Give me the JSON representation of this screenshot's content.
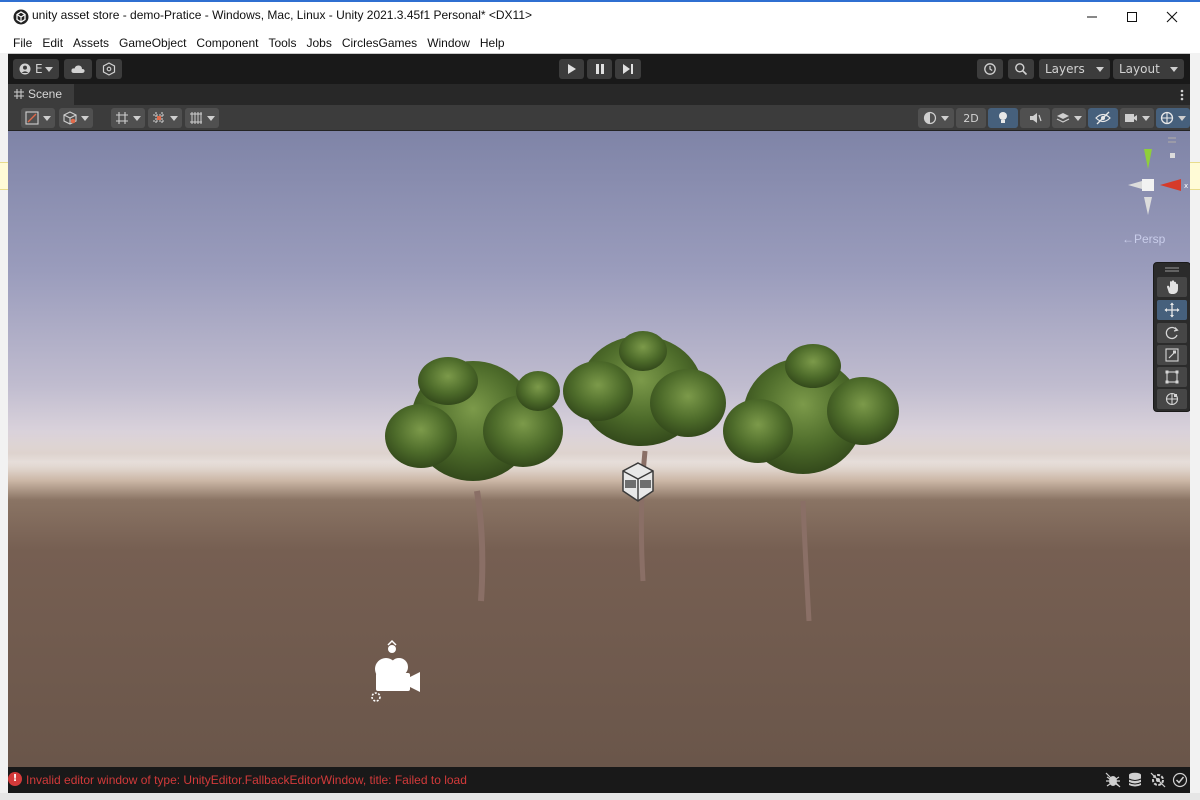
{
  "window": {
    "title": "unity asset store - demo-Pratice - Windows, Mac, Linux - Unity 2021.3.45f1 Personal* <DX11>",
    "controls": [
      "minimize",
      "maximize",
      "close"
    ]
  },
  "menu": {
    "items": [
      "File",
      "Edit",
      "Assets",
      "GameObject",
      "Component",
      "Tools",
      "Jobs",
      "CirclesGames",
      "Window",
      "Help"
    ]
  },
  "toolbar": {
    "account_label": "E",
    "layers_label": "Layers",
    "layout_label": "Layout"
  },
  "scene": {
    "tab_label": "Scene",
    "mode_2d_label": "2D",
    "persp_label": "←Persp",
    "gizmo_axis_x": "x"
  },
  "status": {
    "message": "Invalid editor window of type: UnityEditor.FallbackEditorWindow, title: Failed to load"
  },
  "colors": {
    "accent_active": "#46607c",
    "error": "#d23a3a",
    "toolbar_bg": "#191919"
  }
}
